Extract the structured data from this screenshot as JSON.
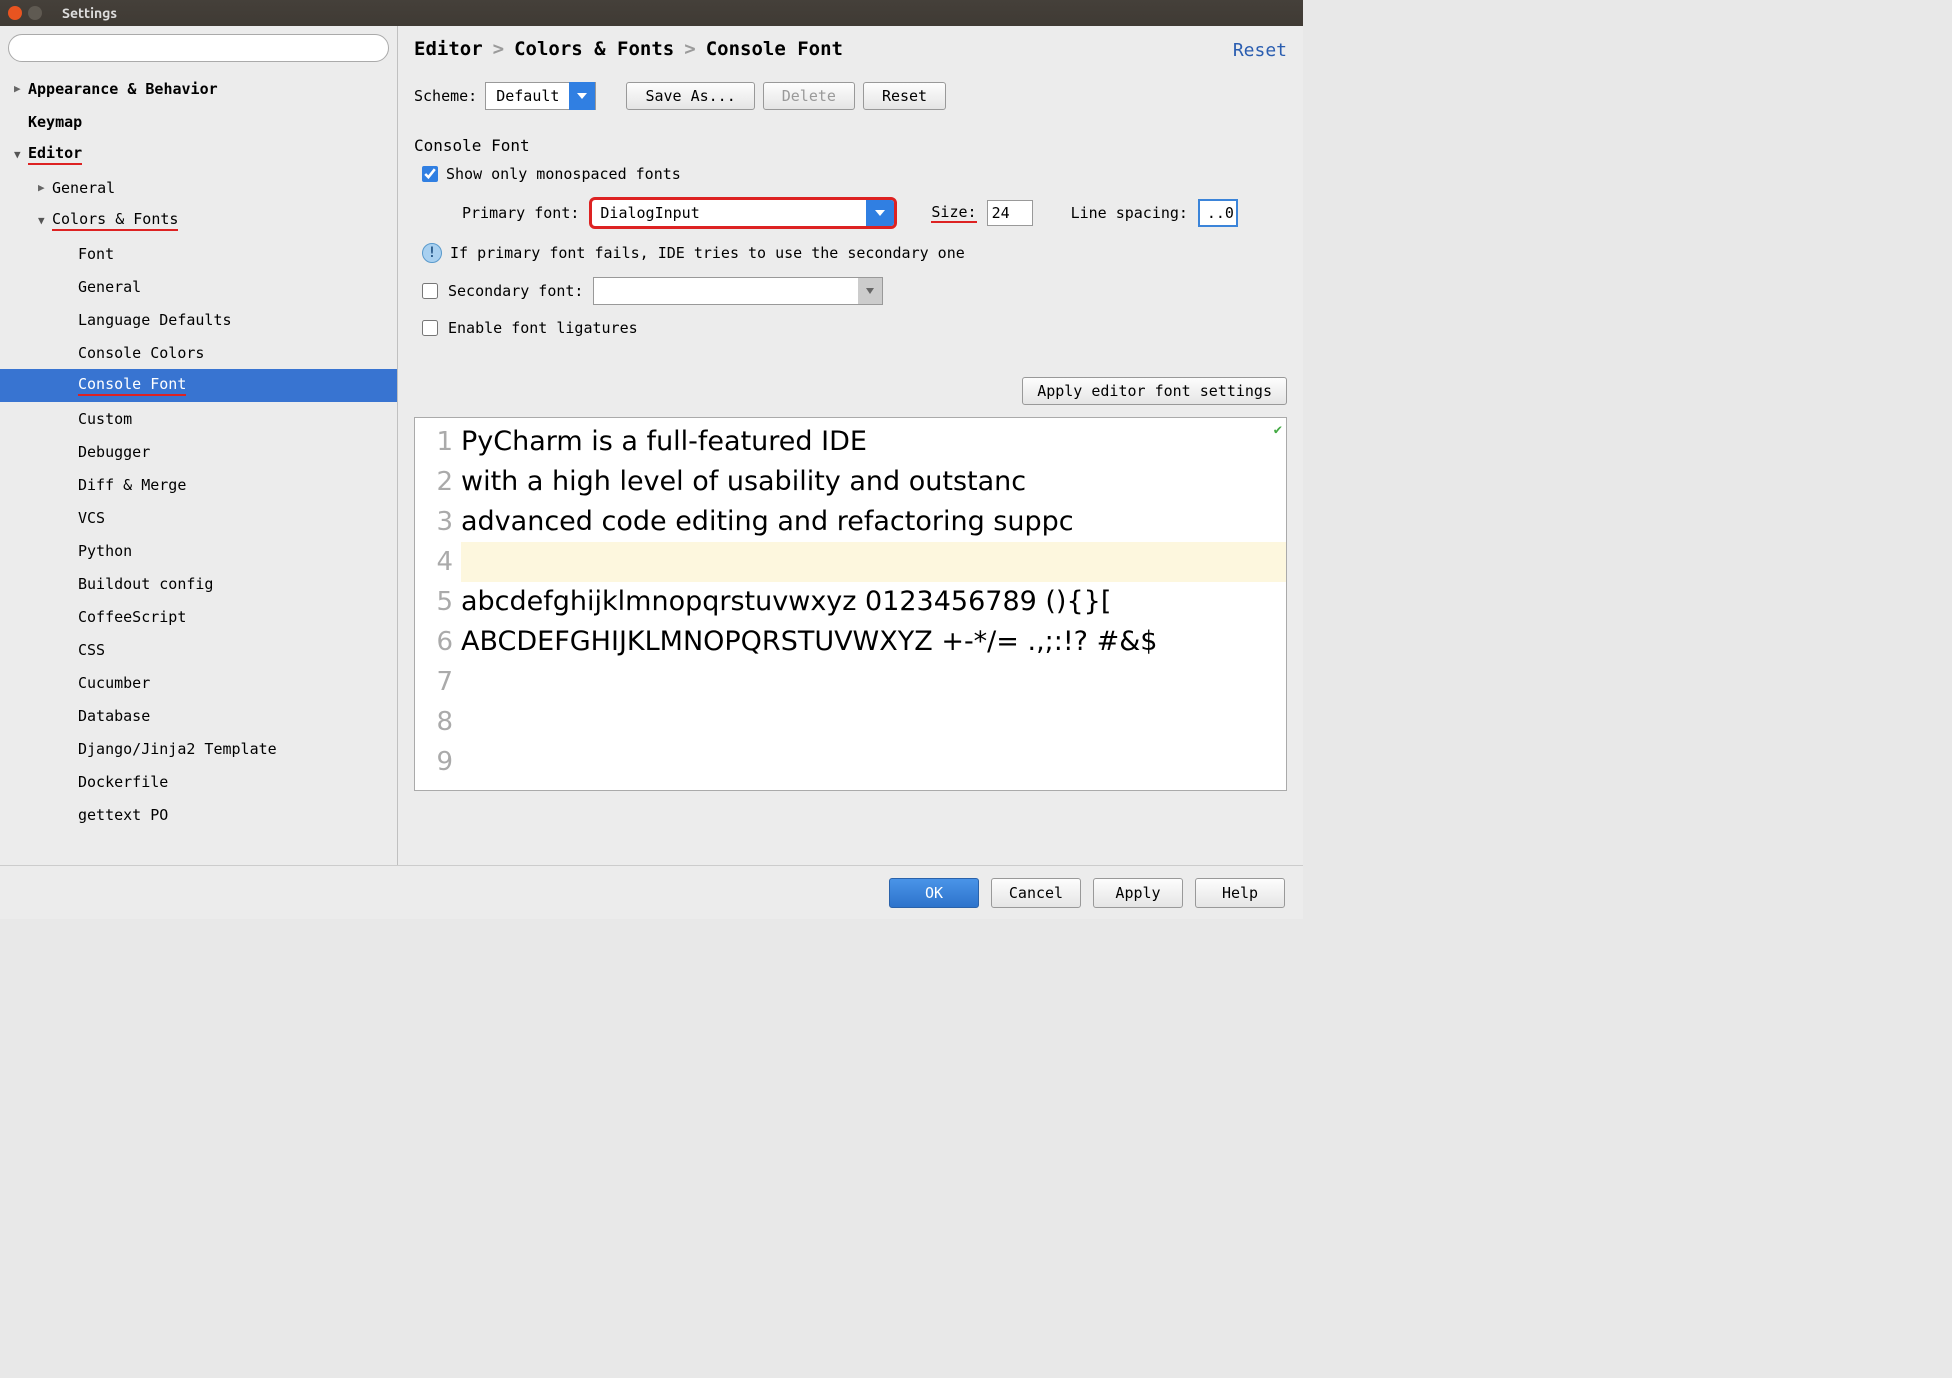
{
  "window": {
    "title": "Settings"
  },
  "search": {
    "placeholder": ""
  },
  "tree": {
    "appearance": "Appearance & Behavior",
    "keymap": "Keymap",
    "editor": "Editor",
    "general": "General",
    "colors_fonts": "Colors & Fonts",
    "items": [
      "Font",
      "General",
      "Language Defaults",
      "Console Colors",
      "Console Font",
      "Custom",
      "Debugger",
      "Diff & Merge",
      "VCS",
      "Python",
      "Buildout config",
      "CoffeeScript",
      "CSS",
      "Cucumber",
      "Database",
      "Django/Jinja2 Template",
      "Dockerfile",
      "gettext PO"
    ]
  },
  "breadcrumb": {
    "a": "Editor",
    "b": "Colors & Fonts",
    "c": "Console Font"
  },
  "reset": "Reset",
  "scheme": {
    "label": "Scheme:",
    "value": "Default"
  },
  "buttons": {
    "save_as": "Save As...",
    "delete": "Delete",
    "reset": "Reset",
    "apply_editor": "Apply editor font settings"
  },
  "section": "Console Font",
  "show_mono": "Show only monospaced fonts",
  "primary": {
    "label": "Primary font:",
    "value": "DialogInput"
  },
  "size": {
    "label": "Size:",
    "value": "24"
  },
  "line_spacing": {
    "label": "Line spacing:",
    "value": "..0"
  },
  "info": "If primary font fails, IDE tries to use the secondary one",
  "secondary": {
    "label": "Secondary font:"
  },
  "ligatures": "Enable font ligatures",
  "preview": {
    "lines": [
      "PyCharm is a full-featured IDE",
      "with a high level of usability and outstanc",
      "advanced code editing and refactoring suppc",
      "",
      "abcdefghijklmnopqrstuvwxyz 0123456789 (){}[",
      "ABCDEFGHIJKLMNOPQRSTUVWXYZ +-*/= .,;:!? #&$",
      "",
      "",
      "",
      ""
    ]
  },
  "footer": {
    "ok": "OK",
    "cancel": "Cancel",
    "apply": "Apply",
    "help": "Help"
  }
}
